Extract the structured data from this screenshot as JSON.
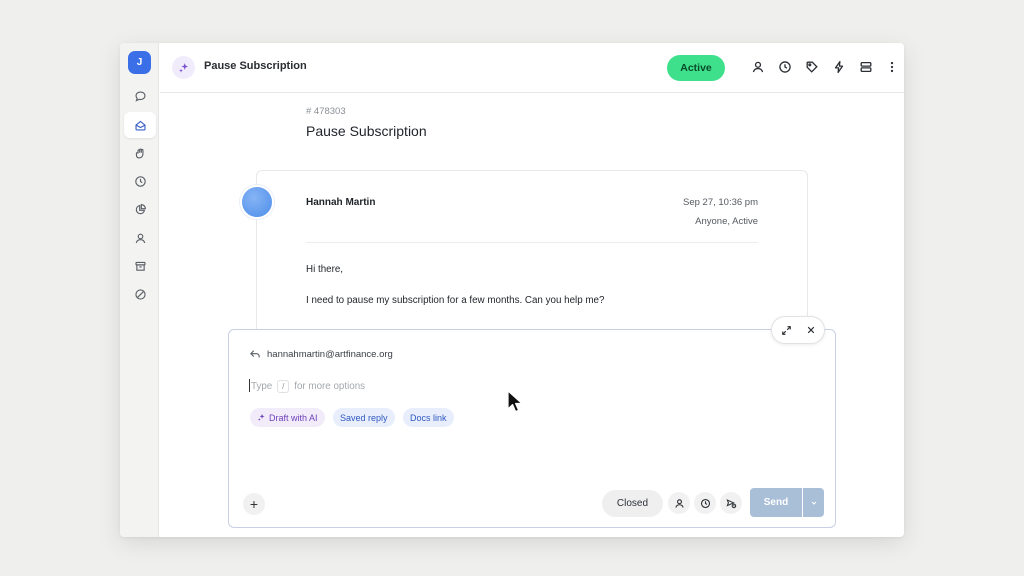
{
  "sidebar": {
    "avatar_initial": "J",
    "items": [
      {
        "icon": "chat-bubble-icon"
      },
      {
        "icon": "inbox-icon",
        "active": true
      },
      {
        "icon": "hand-icon"
      },
      {
        "icon": "clock-icon"
      },
      {
        "icon": "pie-chart-icon"
      },
      {
        "icon": "person-icon"
      },
      {
        "icon": "archive-icon"
      },
      {
        "icon": "blocked-icon"
      }
    ]
  },
  "header": {
    "title": "Pause Subscription",
    "status": "Active",
    "status_color": "#3ee08b",
    "actions": [
      "assignee-icon",
      "clock-icon",
      "tag-icon",
      "lightning-icon",
      "layers-icon",
      "more-vertical-icon"
    ]
  },
  "ticket": {
    "id": "# 478303",
    "title": "Pause Subscription"
  },
  "message": {
    "sender": "Hannah Martin",
    "date": "Sep 27, 10:36 pm",
    "assignment": "Anyone, Active",
    "greeting": "Hi there,",
    "body": "I need to pause my subscription for a few months. Can you help me?"
  },
  "composer": {
    "reply_to": "hannahmartin@artfinance.org",
    "placeholder_prefix": "Type",
    "placeholder_key": "/",
    "placeholder_suffix": "for more options",
    "chips": {
      "ai": "Draft with AI",
      "saved": "Saved reply",
      "docs": "Docs link"
    },
    "add_label": "+",
    "close_status": "Closed",
    "send_label": "Send",
    "accent_color": "#a9bfd7"
  }
}
